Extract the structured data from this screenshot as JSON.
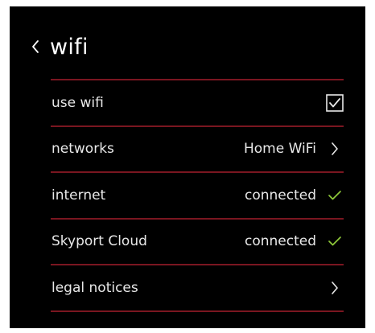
{
  "header": {
    "title": "wifi",
    "back_icon": "chevron-left-icon"
  },
  "colors": {
    "background": "#000000",
    "divider": "#7a1620",
    "text": "#e8e8e8",
    "check": "#8fc93a"
  },
  "rows": [
    {
      "label": "use wifi",
      "value": "",
      "icon": "checkbox-checked-icon",
      "checked": true
    },
    {
      "label": "networks",
      "value": "Home WiFi",
      "icon": "chevron-right-icon"
    },
    {
      "label": "internet",
      "value": "connected",
      "icon": "check-icon"
    },
    {
      "label": "Skyport Cloud",
      "value": "connected",
      "icon": "check-icon"
    },
    {
      "label": "legal notices",
      "value": "",
      "icon": "chevron-right-icon"
    }
  ]
}
